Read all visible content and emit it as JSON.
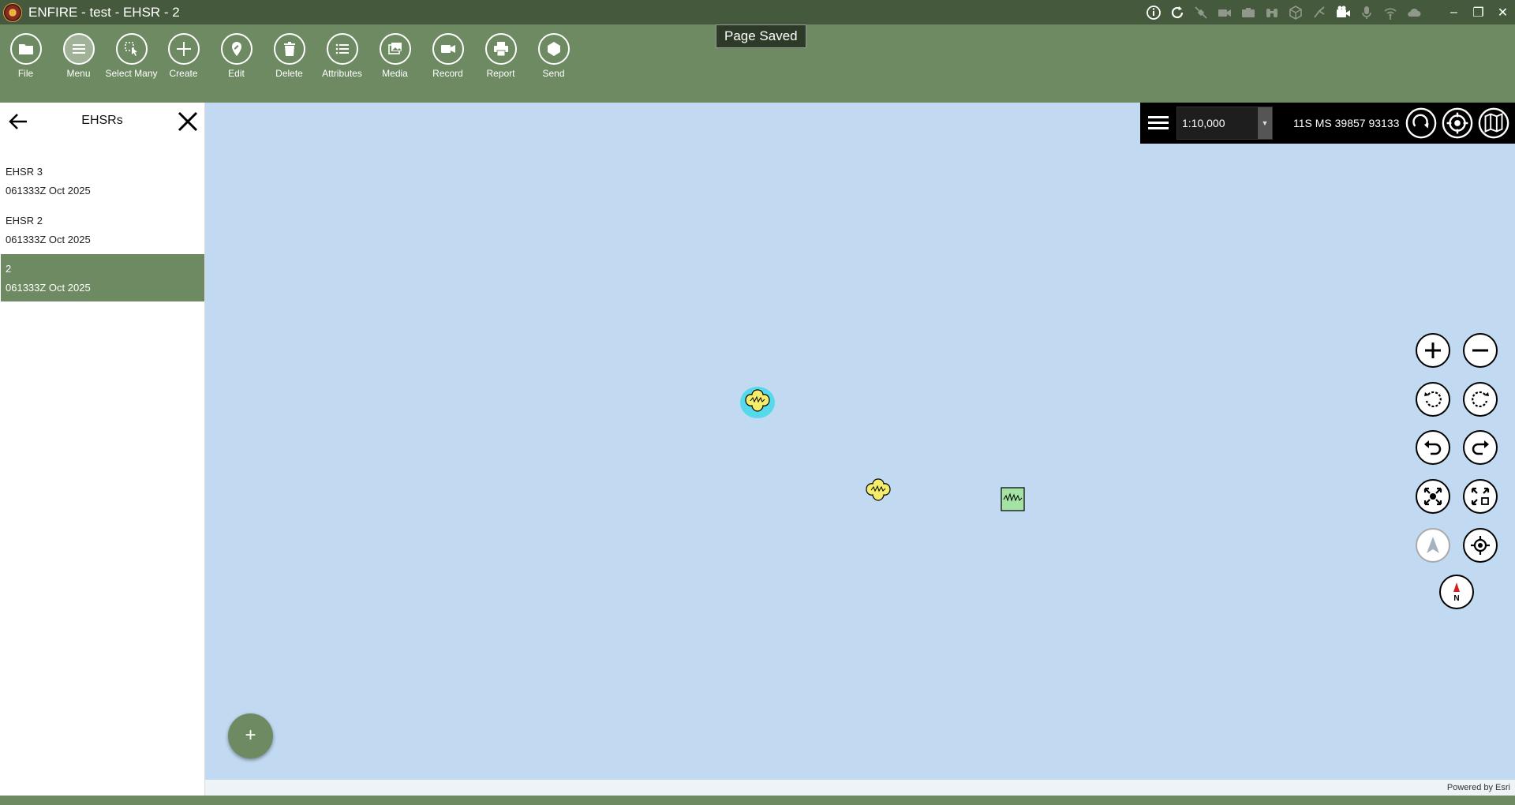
{
  "window": {
    "title": "ENFIRE - test - EHSR - 2",
    "controls": {
      "minimize": "–",
      "restore": "❐",
      "close": "✕"
    },
    "status_icons": [
      "info-icon",
      "refresh-icon",
      "satellite-off-icon",
      "video-camera-icon",
      "camera-icon",
      "binoculars-icon",
      "cube-icon",
      "measure-icon",
      "video-icon",
      "microphone-icon",
      "antenna-icon",
      "cloud-icon"
    ]
  },
  "ribbon": {
    "buttons": [
      {
        "label": "File",
        "icon": "folder-icon"
      },
      {
        "label": "Menu",
        "icon": "menu-icon",
        "active": true
      },
      {
        "label": "Select Many",
        "icon": "select-many-icon"
      },
      {
        "label": "Create",
        "icon": "plus-icon"
      },
      {
        "label": "Edit",
        "icon": "pin-edit-icon"
      },
      {
        "label": "Delete",
        "icon": "trash-icon"
      },
      {
        "label": "Attributes",
        "icon": "list-icon"
      },
      {
        "label": "Media",
        "icon": "images-icon"
      },
      {
        "label": "Record",
        "icon": "video-camera-icon"
      },
      {
        "label": "Report",
        "icon": "printer-icon"
      },
      {
        "label": "Send",
        "icon": "send-icon"
      }
    ],
    "toast": "Page Saved"
  },
  "panel": {
    "title": "EHSRs",
    "items": [
      {
        "name": "EHSR 3",
        "time": "061333Z Oct 2025",
        "selected": false
      },
      {
        "name": "EHSR 2",
        "time": "061333Z Oct 2025",
        "selected": false
      },
      {
        "name": "2",
        "time": "061333Z Oct 2025",
        "selected": true
      }
    ]
  },
  "map": {
    "scale": "1:10,000",
    "coordinates": "11S MS 39857 93133",
    "attribution": "Powered by Esri",
    "fab_label": "+",
    "compass_label": "N",
    "colors": {
      "water": "#c1d9f1",
      "accent": "#6e8a62",
      "dark_accent": "#455a3c",
      "marker_yellow": "#f5ec6b",
      "marker_green": "#a4e3a4",
      "highlight": "#00d8e8"
    }
  }
}
